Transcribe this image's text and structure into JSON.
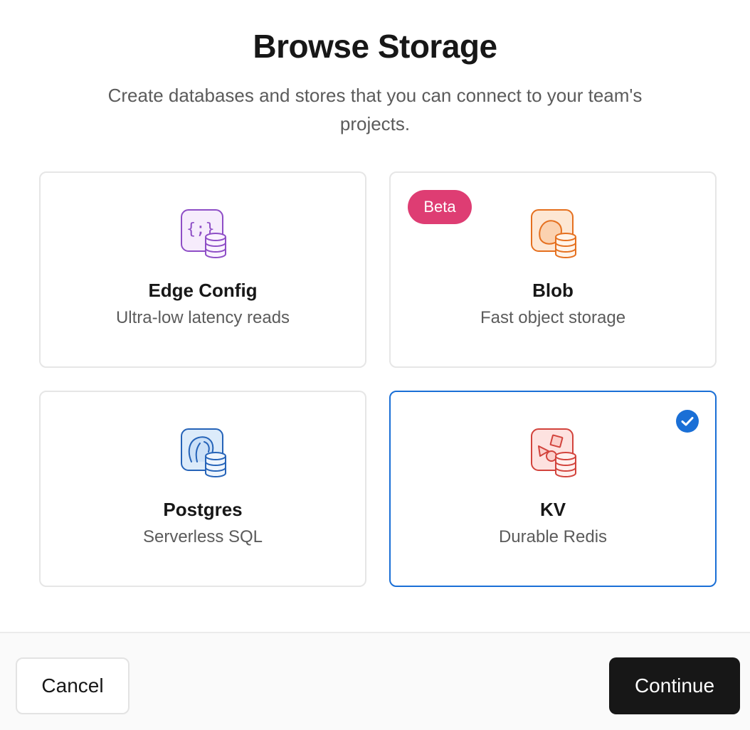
{
  "dialog": {
    "title": "Browse Storage",
    "subtitle": "Create databases and stores that you can connect to your team's projects."
  },
  "cards": [
    {
      "title": "Edge Config",
      "description": "Ultra-low latency reads",
      "icon": "edge-config-icon",
      "accent": "#8e4ec6",
      "selected": false
    },
    {
      "title": "Blob",
      "description": "Fast object storage",
      "icon": "blob-icon",
      "accent": "#e5701f",
      "badge": "Beta",
      "badge_color": "#de3d73",
      "selected": false
    },
    {
      "title": "Postgres",
      "description": "Serverless SQL",
      "icon": "postgres-icon",
      "accent": "#2563b8",
      "selected": false
    },
    {
      "title": "KV",
      "description": "Durable Redis",
      "icon": "kv-icon",
      "accent": "#d2433c",
      "selected": true
    }
  ],
  "selection_color": "#1a6fd6",
  "footer": {
    "cancel_label": "Cancel",
    "continue_label": "Continue"
  }
}
